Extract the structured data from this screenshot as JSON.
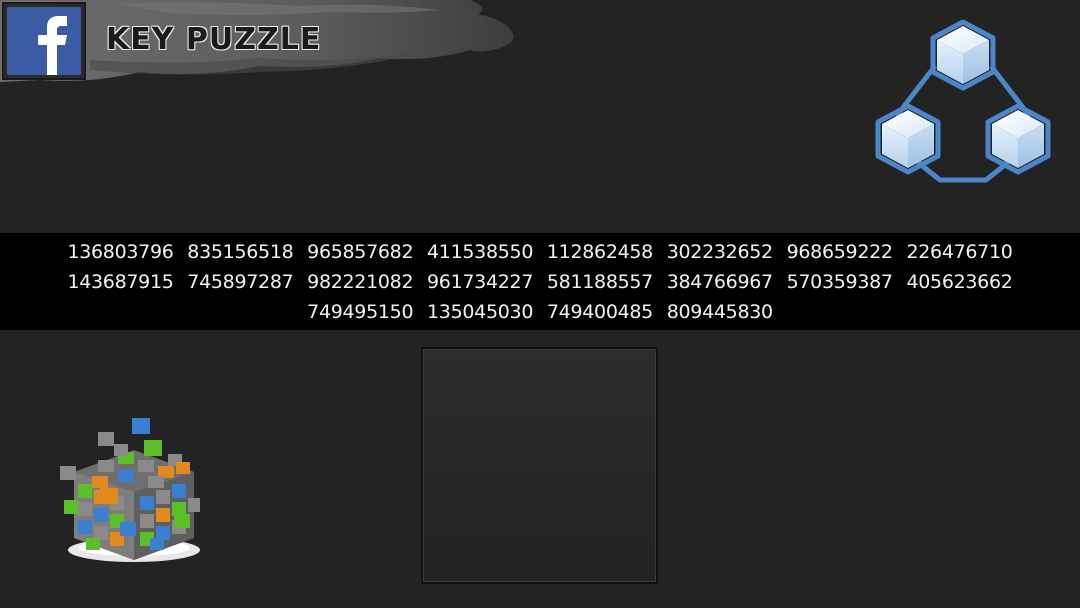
{
  "header": {
    "title": "KEY PUZZLE",
    "facebook_icon": "facebook-f-icon"
  },
  "network_button": {
    "icon": "cube-network-icon",
    "color": "#4a86c8"
  },
  "numbers": [
    "136803796",
    "835156518",
    "965857682",
    "411538550",
    "112862458",
    "302232652",
    "968659222",
    "226476710",
    "143687915",
    "745897287",
    "982221082",
    "961734227",
    "581188557",
    "384766967",
    "570359387",
    "405623662",
    "749495150",
    "135045030",
    "749400485",
    "809445830"
  ],
  "logo": {
    "icon": "multicolor-cube-cluster-icon",
    "colors": [
      "#3a7fd0",
      "#e38a1e",
      "#5cbf2a",
      "#8a8a8a"
    ]
  },
  "colors": {
    "background": "#232324",
    "strip": "#000000",
    "facebook_blue": "#3b5ba5"
  }
}
